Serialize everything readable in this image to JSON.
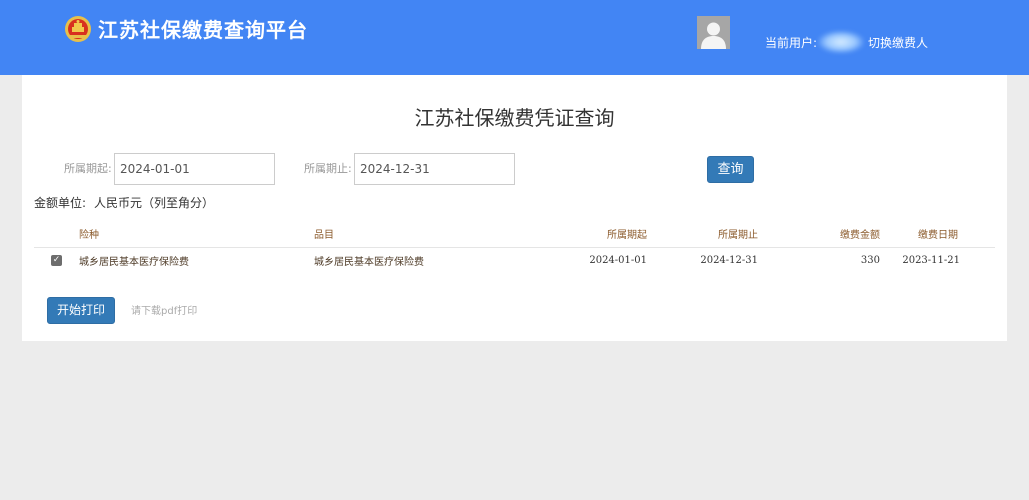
{
  "header": {
    "site_title": "江苏社保缴费查询平台",
    "user_label": "当前用户:",
    "switch_payer": "切换缴费人",
    "bg_color": "#4285f4"
  },
  "main": {
    "page_title": "江苏社保缴费凭证查询",
    "start_label": "所属期起:",
    "start_value": "2024-01-01",
    "end_label": "所属期止:",
    "end_value": "2024-12-31",
    "query_button": "查询",
    "unit_label": "金额单位:",
    "unit_value": "人民币元（列至角分）",
    "table": {
      "headers": [
        "险种",
        "品目",
        "所属期起",
        "所属期止",
        "缴费金额",
        "缴费日期"
      ],
      "rows": [
        {
          "checked": true,
          "insurance_type": "城乡居民基本医疗保险费",
          "item": "城乡居民基本医疗保险费",
          "period_start": "2024-01-01",
          "period_end": "2024-12-31",
          "amount": "330",
          "pay_date": "2023-11-21"
        }
      ]
    },
    "print_button": "开始打印",
    "pdf_hint": "请下载pdf打印"
  },
  "icons": {
    "emblem": "national-emblem-icon",
    "avatar": "user-avatar-icon",
    "checkbox": "checkbox-checked-icon"
  }
}
